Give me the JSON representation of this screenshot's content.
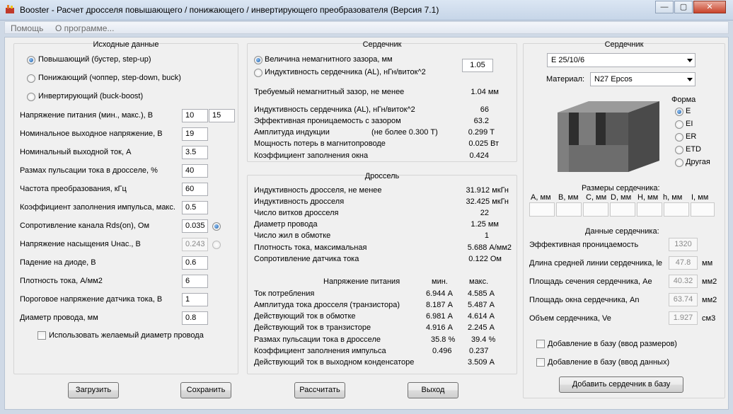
{
  "window": {
    "title": "Booster - Расчет дросселя повышающего / понижающего / инвертирующего преобразователя (Версия 7.1)",
    "minimize": "—",
    "maximize": "▢",
    "close": "✕"
  },
  "menu": {
    "help": "Помощь",
    "about": "О программе..."
  },
  "input": {
    "title": "Исходные данные",
    "modes": [
      "Повышающий (бустер, step-up)",
      "Понижающий (чоппер, step-down, buck)",
      "Инвертирующий (buck-boost)"
    ],
    "fields": {
      "supply_label": "Напряжение питания (мин., макс.), В",
      "supply_min": "10",
      "supply_max": "15",
      "vout_label": "Номинальное выходное напряжение, В",
      "vout": "19",
      "iout_label": "Номинальный выходной ток, А",
      "iout": "3.5",
      "ripple_label": "Размах пульсации тока в дросселе, %",
      "ripple": "40",
      "freq_label": "Частота преобразования, кГц",
      "freq": "60",
      "duty_label": "Коэффициент заполнения импульса, макс.",
      "duty": "0.5",
      "rds_label": "Сопротивление канала Rds(on), Ом",
      "rds": "0.035",
      "usat_label": "Напряжение насыщения Uнас., В",
      "usat": "0.243",
      "vdiode_label": "Падение на диоде, В",
      "vdiode": "0.6",
      "jdens_label": "Плотность тока, А/мм2",
      "jdens": "6",
      "vsense_label": "Пороговое напряжение датчика тока, В",
      "vsense": "1",
      "wire_label": "Диаметр провода, мм",
      "wire": "0.8"
    },
    "use_wire_label": "Использовать желаемый диаметр провода"
  },
  "core": {
    "title": "Сердечник",
    "gap_radio": "Величина немагнитного зазора, мм",
    "gap_value": "1.05",
    "al_radio": "Индуктивность сердечника (AL), нГн/виток^2",
    "required_gap_label": "Требуемый немагнитный зазор, не менее",
    "required_gap": "1.04 мм",
    "rows": [
      {
        "label": "Индуктивность сердечника (AL), нГн/виток^2",
        "value": "66"
      },
      {
        "label": "Эффективная проницаемость с зазором",
        "value": "63.2"
      },
      {
        "label": "Амплитуда индукции",
        "note": "(не более 0.300 Т)",
        "value": "0.299 Т"
      },
      {
        "label": "Мощность потерь в магнитопроводе",
        "value": "0.025 Вт"
      },
      {
        "label": "Коэффициент заполнения окна",
        "value": "0.424"
      }
    ]
  },
  "choke": {
    "title": "Дроссель",
    "rows": [
      {
        "label": "Индуктивность дросселя, не менее",
        "value": "31.912 мкГн"
      },
      {
        "label": "Индуктивность дросселя",
        "value": "32.425 мкГн"
      },
      {
        "label": "Число витков дросселя",
        "value": "22"
      },
      {
        "label": "Диаметр провода",
        "value": "1.25 мм"
      },
      {
        "label": "Число жил в обмотке",
        "value": "1"
      },
      {
        "label": "Плотность тока, максимальная",
        "value": "5.688 А/мм2"
      },
      {
        "label": "Сопротивление датчика тока",
        "value": "0.122 Ом"
      }
    ],
    "supply_header": "Напряжение питания",
    "min_header": "мин.",
    "max_header": "макс.",
    "table": [
      {
        "label": "Ток потребления",
        "min": "6.944 А",
        "max": "4.585 А"
      },
      {
        "label": "Амплитуда тока дросселя (транзистора)",
        "min": "8.187 А",
        "max": "5.487 А"
      },
      {
        "label": "Действующий ток в обмотке",
        "min": "6.981 А",
        "max": "4.614 А"
      },
      {
        "label": "Действующий ток в транзисторе",
        "min": "4.916 А",
        "max": "2.245 А"
      },
      {
        "label": "Размах пульсации тока в дросселе",
        "min": "35.8 %",
        "max": "39.4 %"
      },
      {
        "label": "Коэффициент заполнения импульса",
        "min": "0.496",
        "max": "0.237"
      }
    ],
    "cap_label": "Действующий ток в выходном конденсаторе",
    "cap_value": "3.509 А"
  },
  "core_select": {
    "title": "Сердечник",
    "core": "E 25/10/6",
    "material_label": "Материал:",
    "material": "N27 Epcos",
    "shape_title": "Форма",
    "shapes": [
      "E",
      "EI",
      "ER",
      "ETD",
      "Другая"
    ],
    "dims_title": "Размеры сердечника:",
    "dims": [
      "A, мм",
      "B, мм",
      "C, мм",
      "D, мм",
      "H, мм",
      "h, мм",
      "I, мм"
    ],
    "data_title": "Данные сердечника:",
    "data": [
      {
        "label": "Эффективная проницаемость",
        "value": "1320",
        "unit": ""
      },
      {
        "label": "Длина средней линии сердечника, le",
        "value": "47.8",
        "unit": "мм"
      },
      {
        "label": "Площадь сечения сердечника, Ae",
        "value": "40.32",
        "unit": "мм2"
      },
      {
        "label": "Площадь окна сердечника, An",
        "value": "63.74",
        "unit": "мм2"
      },
      {
        "label": "Объем сердечника, Ve",
        "value": "1.927",
        "unit": "см3"
      }
    ],
    "add_dims": "Добавление в базу (ввод размеров)",
    "add_data": "Добавление в базу (ввод данных)",
    "add_button": "Добавить сердечник в базу"
  },
  "buttons": {
    "load": "Загрузить",
    "save": "Сохранить",
    "calc": "Рассчитать",
    "exit": "Выход"
  }
}
